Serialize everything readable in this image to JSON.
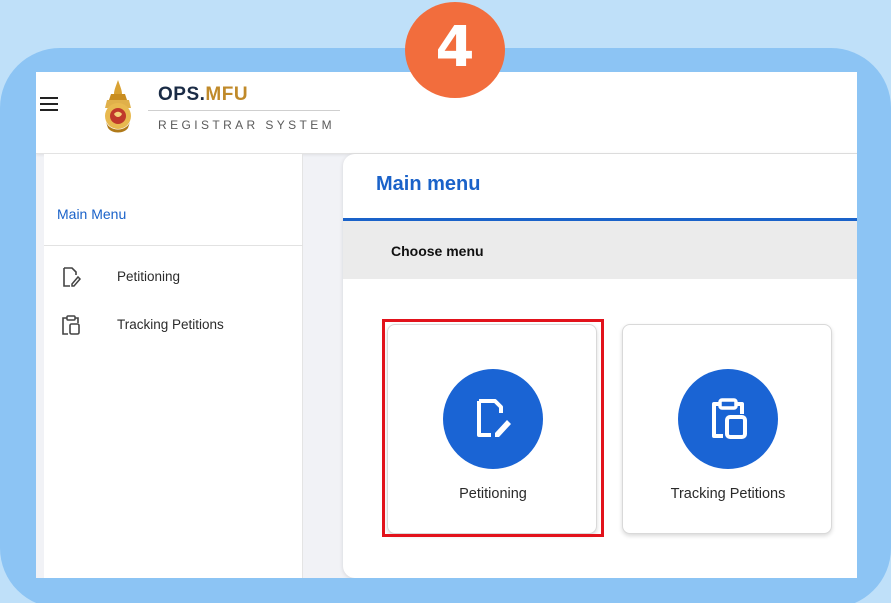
{
  "step": {
    "number": "4"
  },
  "header": {
    "brand_title_main": "OPS.",
    "brand_title_accent": "MFU",
    "brand_subtitle": "REGISTRAR SYSTEM"
  },
  "sidebar": {
    "title": "Main Menu",
    "items": [
      {
        "label": "Petitioning",
        "icon": "edit-document-icon"
      },
      {
        "label": "Tracking Petitions",
        "icon": "clipboard-icon"
      }
    ]
  },
  "main": {
    "title": "Main menu",
    "section_label": "Choose menu",
    "cards": [
      {
        "label": "Petitioning",
        "icon": "edit-document-icon",
        "highlighted": true
      },
      {
        "label": "Tracking Petitions",
        "icon": "clipboard-icon",
        "highlighted": false
      }
    ]
  },
  "colors": {
    "accent_blue": "#1a64d4",
    "highlight_red": "#e2121b",
    "badge_orange": "#f26d3d",
    "frame_blue": "#8cc4f4"
  }
}
